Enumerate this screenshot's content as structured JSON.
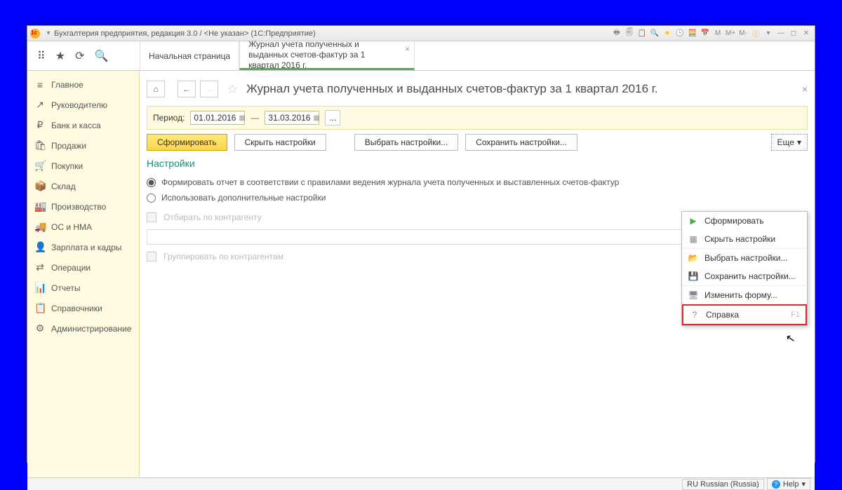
{
  "title": "Бухгалтерия предприятия, редакция 3.0 / <Не указан>  (1С:Предприятие)",
  "top_tabs": {
    "start": "Начальная страница",
    "active": "Журнал учета полученных и выданных счетов-фактур за 1 квартал 2016 г."
  },
  "sidebar": [
    {
      "icon": "≡",
      "label": "Главное"
    },
    {
      "icon": "↗",
      "label": "Руководителю"
    },
    {
      "icon": "₽",
      "label": "Банк и касса"
    },
    {
      "icon": "🛍",
      "label": "Продажи"
    },
    {
      "icon": "🛒",
      "label": "Покупки"
    },
    {
      "icon": "📦",
      "label": "Склад"
    },
    {
      "icon": "🏭",
      "label": "Производство"
    },
    {
      "icon": "🚚",
      "label": "ОС и НМА"
    },
    {
      "icon": "👤",
      "label": "Зарплата и кадры"
    },
    {
      "icon": "⇄",
      "label": "Операции"
    },
    {
      "icon": "📊",
      "label": "Отчеты"
    },
    {
      "icon": "📋",
      "label": "Справочники"
    },
    {
      "icon": "⚙",
      "label": "Администрирование"
    }
  ],
  "page": {
    "title": "Журнал учета полученных и выданных счетов-фактур за 1 квартал 2016 г.",
    "period_label": "Период:",
    "date_from": "01.01.2016",
    "date_to": "31.03.2016",
    "dots": "..."
  },
  "buttons": {
    "form": "Сформировать",
    "hide": "Скрыть настройки",
    "choose": "Выбрать настройки...",
    "save": "Сохранить настройки...",
    "more": "Еще"
  },
  "settings": {
    "title": "Настройки",
    "opt1": "Формировать отчет в соответствии с правилами ведения журнала учета полученных и выставленных счетов-фактур",
    "opt2": "Использовать дополнительные настройки",
    "filter1": "Отбирать по контрагенту",
    "filter2": "Группировать по контрагентам"
  },
  "dropdown": [
    {
      "icon": "▶",
      "label": "Сформировать",
      "color": "#4caf50"
    },
    {
      "icon": "▦",
      "label": "Скрыть настройки"
    },
    {
      "icon": "📂",
      "label": "Выбрать настройки..."
    },
    {
      "icon": "💾",
      "label": "Сохранить настройки..."
    },
    {
      "icon": "🖥",
      "label": "Изменить форму...",
      "sep": true
    },
    {
      "icon": "?",
      "label": "Справка",
      "hint": "F1",
      "sel": true
    }
  ],
  "status": {
    "lang": "RU Russian (Russia)",
    "help": "Help"
  }
}
